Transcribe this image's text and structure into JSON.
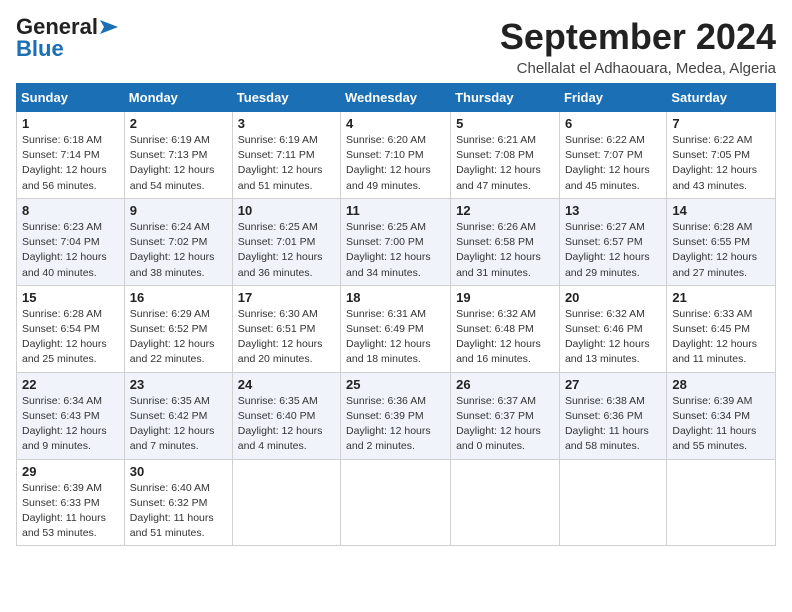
{
  "logo": {
    "general": "General",
    "blue": "Blue"
  },
  "title": "September 2024",
  "location": "Chellalat el Adhaouara, Medea, Algeria",
  "weekdays": [
    "Sunday",
    "Monday",
    "Tuesday",
    "Wednesday",
    "Thursday",
    "Friday",
    "Saturday"
  ],
  "weeks": [
    [
      {
        "day": "1",
        "sunrise": "6:18 AM",
        "sunset": "7:14 PM",
        "daylight": "12 hours and 56 minutes."
      },
      {
        "day": "2",
        "sunrise": "6:19 AM",
        "sunset": "7:13 PM",
        "daylight": "12 hours and 54 minutes."
      },
      {
        "day": "3",
        "sunrise": "6:19 AM",
        "sunset": "7:11 PM",
        "daylight": "12 hours and 51 minutes."
      },
      {
        "day": "4",
        "sunrise": "6:20 AM",
        "sunset": "7:10 PM",
        "daylight": "12 hours and 49 minutes."
      },
      {
        "day": "5",
        "sunrise": "6:21 AM",
        "sunset": "7:08 PM",
        "daylight": "12 hours and 47 minutes."
      },
      {
        "day": "6",
        "sunrise": "6:22 AM",
        "sunset": "7:07 PM",
        "daylight": "12 hours and 45 minutes."
      },
      {
        "day": "7",
        "sunrise": "6:22 AM",
        "sunset": "7:05 PM",
        "daylight": "12 hours and 43 minutes."
      }
    ],
    [
      {
        "day": "8",
        "sunrise": "6:23 AM",
        "sunset": "7:04 PM",
        "daylight": "12 hours and 40 minutes."
      },
      {
        "day": "9",
        "sunrise": "6:24 AM",
        "sunset": "7:02 PM",
        "daylight": "12 hours and 38 minutes."
      },
      {
        "day": "10",
        "sunrise": "6:25 AM",
        "sunset": "7:01 PM",
        "daylight": "12 hours and 36 minutes."
      },
      {
        "day": "11",
        "sunrise": "6:25 AM",
        "sunset": "7:00 PM",
        "daylight": "12 hours and 34 minutes."
      },
      {
        "day": "12",
        "sunrise": "6:26 AM",
        "sunset": "6:58 PM",
        "daylight": "12 hours and 31 minutes."
      },
      {
        "day": "13",
        "sunrise": "6:27 AM",
        "sunset": "6:57 PM",
        "daylight": "12 hours and 29 minutes."
      },
      {
        "day": "14",
        "sunrise": "6:28 AM",
        "sunset": "6:55 PM",
        "daylight": "12 hours and 27 minutes."
      }
    ],
    [
      {
        "day": "15",
        "sunrise": "6:28 AM",
        "sunset": "6:54 PM",
        "daylight": "12 hours and 25 minutes."
      },
      {
        "day": "16",
        "sunrise": "6:29 AM",
        "sunset": "6:52 PM",
        "daylight": "12 hours and 22 minutes."
      },
      {
        "day": "17",
        "sunrise": "6:30 AM",
        "sunset": "6:51 PM",
        "daylight": "12 hours and 20 minutes."
      },
      {
        "day": "18",
        "sunrise": "6:31 AM",
        "sunset": "6:49 PM",
        "daylight": "12 hours and 18 minutes."
      },
      {
        "day": "19",
        "sunrise": "6:32 AM",
        "sunset": "6:48 PM",
        "daylight": "12 hours and 16 minutes."
      },
      {
        "day": "20",
        "sunrise": "6:32 AM",
        "sunset": "6:46 PM",
        "daylight": "12 hours and 13 minutes."
      },
      {
        "day": "21",
        "sunrise": "6:33 AM",
        "sunset": "6:45 PM",
        "daylight": "12 hours and 11 minutes."
      }
    ],
    [
      {
        "day": "22",
        "sunrise": "6:34 AM",
        "sunset": "6:43 PM",
        "daylight": "12 hours and 9 minutes."
      },
      {
        "day": "23",
        "sunrise": "6:35 AM",
        "sunset": "6:42 PM",
        "daylight": "12 hours and 7 minutes."
      },
      {
        "day": "24",
        "sunrise": "6:35 AM",
        "sunset": "6:40 PM",
        "daylight": "12 hours and 4 minutes."
      },
      {
        "day": "25",
        "sunrise": "6:36 AM",
        "sunset": "6:39 PM",
        "daylight": "12 hours and 2 minutes."
      },
      {
        "day": "26",
        "sunrise": "6:37 AM",
        "sunset": "6:37 PM",
        "daylight": "12 hours and 0 minutes."
      },
      {
        "day": "27",
        "sunrise": "6:38 AM",
        "sunset": "6:36 PM",
        "daylight": "11 hours and 58 minutes."
      },
      {
        "day": "28",
        "sunrise": "6:39 AM",
        "sunset": "6:34 PM",
        "daylight": "11 hours and 55 minutes."
      }
    ],
    [
      {
        "day": "29",
        "sunrise": "6:39 AM",
        "sunset": "6:33 PM",
        "daylight": "11 hours and 53 minutes."
      },
      {
        "day": "30",
        "sunrise": "6:40 AM",
        "sunset": "6:32 PM",
        "daylight": "11 hours and 51 minutes."
      },
      null,
      null,
      null,
      null,
      null
    ]
  ]
}
